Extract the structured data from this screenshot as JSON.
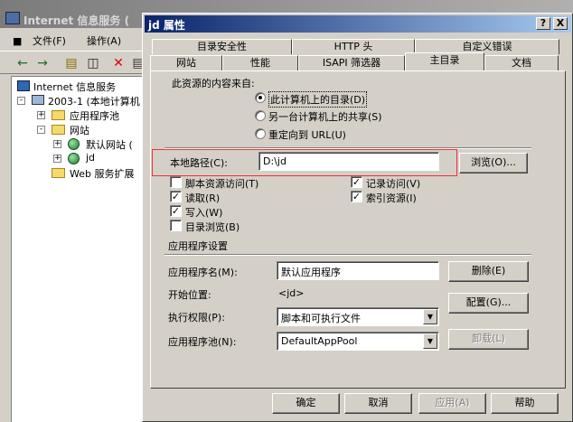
{
  "background_window": {
    "title": "Internet 信息服务 (",
    "menu": [
      "文件(F)",
      "操作(A)"
    ],
    "toolbar_icons": [
      "back-arrow-icon",
      "forward-arrow-icon",
      "up-folder-icon",
      "show-tree-icon",
      "delete-icon",
      "properties-icon"
    ],
    "tree": {
      "root": "Internet 信息服务",
      "server": "2003-1 (本地计算机",
      "app_pools": "应用程序池",
      "websites": "网站",
      "default_site": "默认网站 (",
      "jd_site": "jd",
      "web_ext": "Web 服务扩展"
    }
  },
  "dialog": {
    "title": "jd 属性",
    "help_btn": "?",
    "close_btn": "X",
    "tabs_row1": [
      "目录安全性",
      "HTTP 头",
      "自定义错误"
    ],
    "tabs_row2": [
      "网站",
      "性能",
      "ISAPI 筛选器",
      "主目录",
      "文档"
    ],
    "active_tab": "主目录",
    "content_source_label": "此资源的内容来自:",
    "radios": [
      {
        "label": "此计算机上的目录(D)",
        "checked": true
      },
      {
        "label": "另一台计算机上的共享(S)",
        "checked": false
      },
      {
        "label": "重定向到 URL(U)",
        "checked": false
      }
    ],
    "local_path_label": "本地路径(C):",
    "local_path_value": "D:\\jd",
    "browse_btn": "浏览(O)...",
    "checkboxes_left": [
      {
        "label": "脚本资源访问(T)",
        "checked": false
      },
      {
        "label": "读取(R)",
        "checked": true
      },
      {
        "label": "写入(W)",
        "checked": true
      },
      {
        "label": "目录浏览(B)",
        "checked": false
      }
    ],
    "checkboxes_right": [
      {
        "label": "记录访问(V)",
        "checked": true
      },
      {
        "label": "索引资源(I)",
        "checked": true
      }
    ],
    "app_settings_label": "应用程序设置",
    "app_name_label": "应用程序名(M):",
    "app_name_value": "默认应用程序",
    "remove_btn": "删除(E)",
    "start_point_label": "开始位置:",
    "start_point_value": "<jd>",
    "config_btn": "配置(G)...",
    "exec_perm_label": "执行权限(P):",
    "exec_perm_value": "脚本和可执行文件",
    "app_pool_label": "应用程序池(N):",
    "app_pool_value": "DefaultAppPool",
    "unload_btn": "卸载(L)",
    "ok_btn": "确定",
    "cancel_btn": "取消",
    "apply_btn": "应用(A)",
    "help_bottom_btn": "帮助",
    "highlight_color": "#e33333"
  }
}
